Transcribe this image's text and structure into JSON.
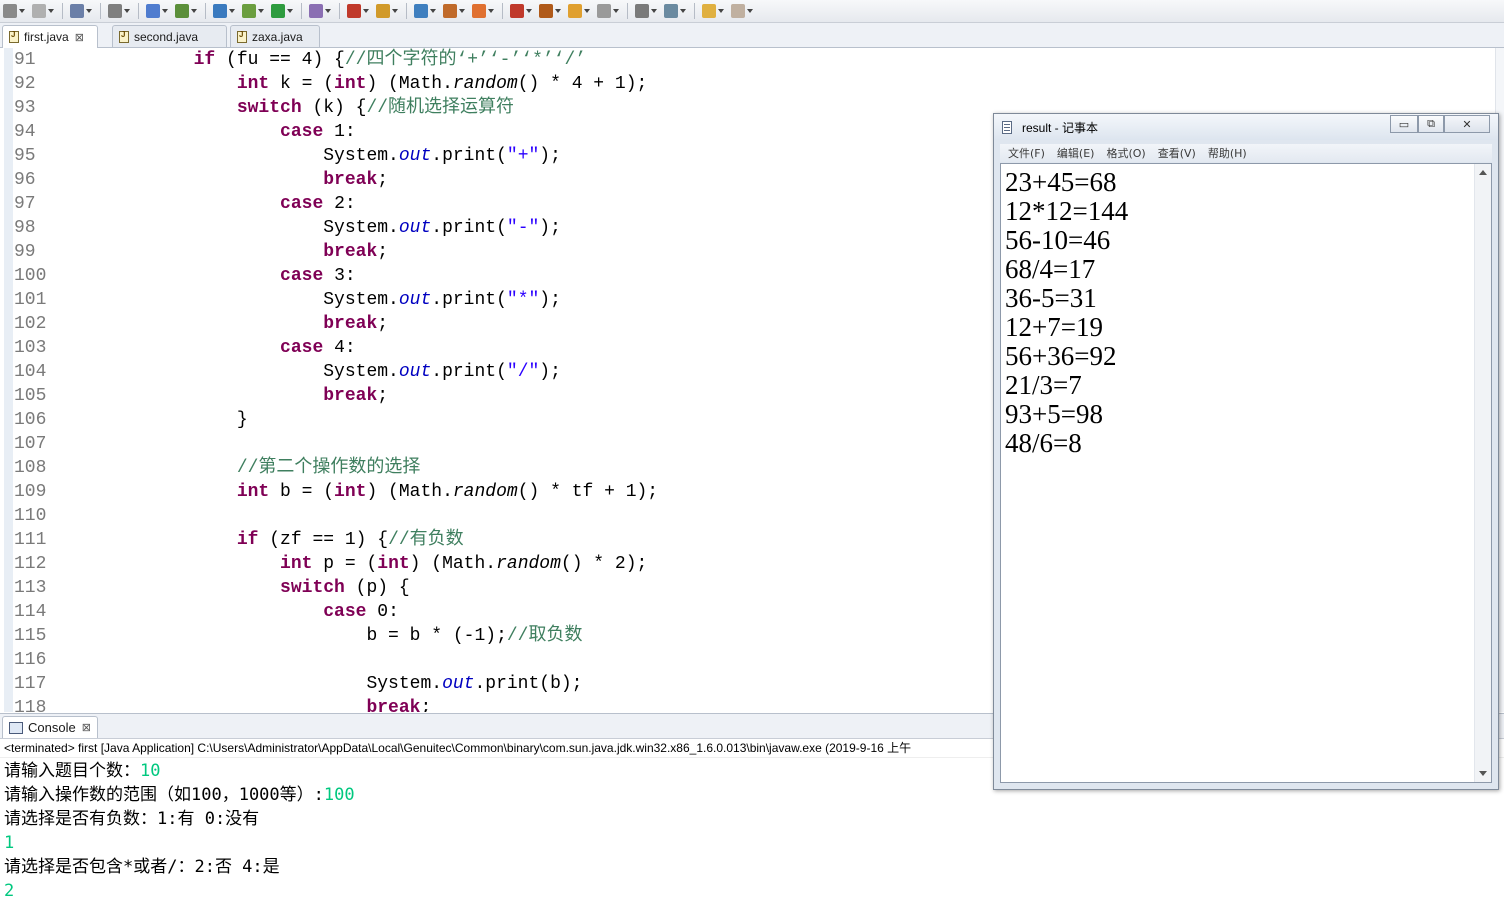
{
  "editor_tabs": [
    {
      "label": "first.java",
      "active": true,
      "close": "⊠"
    },
    {
      "label": "second.java",
      "active": false
    },
    {
      "label": "zaxa.java",
      "active": false
    }
  ],
  "code_lines": [
    {
      "n": "91",
      "code": [
        [
          "            ",
          ""
        ],
        [
          "if",
          "kw"
        ],
        [
          " (fu == 4) {",
          ""
        ],
        [
          "//四个字符的‘+’‘-’‘*’‘/’",
          "cm"
        ]
      ]
    },
    {
      "n": "92",
      "code": [
        [
          "                ",
          ""
        ],
        [
          "int",
          "kw"
        ],
        [
          " k = (",
          ""
        ],
        [
          "int",
          "kw"
        ],
        [
          ") (Math.",
          ""
        ],
        [
          "random",
          "it"
        ],
        [
          "() * 4 + 1);",
          ""
        ]
      ]
    },
    {
      "n": "93",
      "code": [
        [
          "                ",
          ""
        ],
        [
          "switch",
          "kw"
        ],
        [
          " (k) {",
          ""
        ],
        [
          "//随机选择运算符",
          "cm"
        ]
      ]
    },
    {
      "n": "94",
      "code": [
        [
          "                    ",
          ""
        ],
        [
          "case",
          "kw"
        ],
        [
          " 1:",
          ""
        ]
      ]
    },
    {
      "n": "95",
      "code": [
        [
          "                        System.",
          ""
        ],
        [
          "out",
          "fd"
        ],
        [
          ".print(",
          ""
        ],
        [
          "\"+\"",
          "st"
        ],
        [
          ");",
          ""
        ]
      ]
    },
    {
      "n": "96",
      "code": [
        [
          "                        ",
          ""
        ],
        [
          "break",
          "kw"
        ],
        [
          ";",
          ""
        ]
      ]
    },
    {
      "n": "97",
      "code": [
        [
          "                    ",
          ""
        ],
        [
          "case",
          "kw"
        ],
        [
          " 2:",
          ""
        ]
      ]
    },
    {
      "n": "98",
      "code": [
        [
          "                        System.",
          ""
        ],
        [
          "out",
          "fd"
        ],
        [
          ".print(",
          ""
        ],
        [
          "\"-\"",
          "st"
        ],
        [
          ");",
          ""
        ]
      ]
    },
    {
      "n": "99",
      "code": [
        [
          "                        ",
          ""
        ],
        [
          "break",
          "kw"
        ],
        [
          ";",
          ""
        ]
      ]
    },
    {
      "n": "100",
      "code": [
        [
          "                    ",
          ""
        ],
        [
          "case",
          "kw"
        ],
        [
          " 3:",
          ""
        ]
      ]
    },
    {
      "n": "101",
      "code": [
        [
          "                        System.",
          ""
        ],
        [
          "out",
          "fd"
        ],
        [
          ".print(",
          ""
        ],
        [
          "\"*\"",
          "st"
        ],
        [
          ");",
          ""
        ]
      ]
    },
    {
      "n": "102",
      "code": [
        [
          "                        ",
          ""
        ],
        [
          "break",
          "kw"
        ],
        [
          ";",
          ""
        ]
      ]
    },
    {
      "n": "103",
      "code": [
        [
          "                    ",
          ""
        ],
        [
          "case",
          "kw"
        ],
        [
          " 4:",
          ""
        ]
      ]
    },
    {
      "n": "104",
      "code": [
        [
          "                        System.",
          ""
        ],
        [
          "out",
          "fd"
        ],
        [
          ".print(",
          ""
        ],
        [
          "\"/\"",
          "st"
        ],
        [
          ");",
          ""
        ]
      ]
    },
    {
      "n": "105",
      "code": [
        [
          "                        ",
          ""
        ],
        [
          "break",
          "kw"
        ],
        [
          ";",
          ""
        ]
      ]
    },
    {
      "n": "106",
      "code": [
        [
          "                }",
          ""
        ]
      ]
    },
    {
      "n": "107",
      "code": []
    },
    {
      "n": "108",
      "code": [
        [
          "                ",
          ""
        ],
        [
          "//第二个操作数的选择",
          "cm"
        ]
      ]
    },
    {
      "n": "109",
      "code": [
        [
          "                ",
          ""
        ],
        [
          "int",
          "kw"
        ],
        [
          " b = (",
          ""
        ],
        [
          "int",
          "kw"
        ],
        [
          ") (Math.",
          ""
        ],
        [
          "random",
          "it"
        ],
        [
          "() * tf + 1);",
          ""
        ]
      ]
    },
    {
      "n": "110",
      "code": []
    },
    {
      "n": "111",
      "code": [
        [
          "                ",
          ""
        ],
        [
          "if",
          "kw"
        ],
        [
          " (zf == 1) {",
          ""
        ],
        [
          "//有负数",
          "cm"
        ]
      ]
    },
    {
      "n": "112",
      "code": [
        [
          "                    ",
          ""
        ],
        [
          "int",
          "kw"
        ],
        [
          " p = (",
          ""
        ],
        [
          "int",
          "kw"
        ],
        [
          ") (Math.",
          ""
        ],
        [
          "random",
          "it"
        ],
        [
          "() * 2);",
          ""
        ]
      ]
    },
    {
      "n": "113",
      "code": [
        [
          "                    ",
          ""
        ],
        [
          "switch",
          "kw"
        ],
        [
          " (p) {",
          ""
        ]
      ]
    },
    {
      "n": "114",
      "code": [
        [
          "                        ",
          ""
        ],
        [
          "case",
          "kw"
        ],
        [
          " 0:",
          ""
        ]
      ]
    },
    {
      "n": "115",
      "code": [
        [
          "                            b = b * (-1);",
          ""
        ],
        [
          "//取负数",
          "cm"
        ]
      ]
    },
    {
      "n": "116",
      "code": []
    },
    {
      "n": "117",
      "code": [
        [
          "                            System.",
          ""
        ],
        [
          "out",
          "fd"
        ],
        [
          ".print(b);",
          ""
        ]
      ]
    },
    {
      "n": "118",
      "code": [
        [
          "                            ",
          ""
        ],
        [
          "break",
          "kw"
        ],
        [
          ";",
          ""
        ]
      ]
    }
  ],
  "console": {
    "tab_label": "Console",
    "tab_close": "⊠",
    "status": "<terminated> first [Java Application] C:\\Users\\Administrator\\AppData\\Local\\Genuitec\\Common\\binary\\com.sun.java.jdk.win32.x86_1.6.0.013\\bin\\javaw.exe (2019-9-16 上午",
    "lines": [
      {
        "prompt": "请输入题目个数：",
        "input": "10"
      },
      {
        "prompt": "请输入操作数的范围（如100，1000等）:",
        "input": "100"
      },
      {
        "prompt": "请选择是否有负数：1:有 0:没有",
        "input": ""
      },
      {
        "prompt": "",
        "input": "1"
      },
      {
        "prompt": "请选择是否包含*或者/：2:否 4:是",
        "input": ""
      },
      {
        "prompt": "",
        "input": "2"
      }
    ]
  },
  "notepad": {
    "title": "result - 记事本",
    "menu": [
      "文件(F)",
      "编辑(E)",
      "格式(O)",
      "查看(V)",
      "帮助(H)"
    ],
    "buttons": {
      "minimize": "▭",
      "maximize": "⧉",
      "close": "✕"
    },
    "lines": [
      "23+45=68",
      "12*12=144",
      "56-10=46",
      "68/4=17",
      "36-5=31",
      "12+7=19",
      "56+36=92",
      "21/3=7",
      "93+5=98",
      "48/6=8"
    ]
  },
  "toolbar_icon_colors": [
    "#8a8a8a",
    "#b0b0b0",
    "#6b7fa8",
    "#7f7f7f",
    "#4f7ccf",
    "#5b8f3a",
    "#3a7abf",
    "#6b9e3f",
    "#2e9c3f",
    "#8b6fb3",
    "#c0392b",
    "#d19a2a",
    "#3f7fbf",
    "#c06a2a",
    "#e07030",
    "#c0392b",
    "#b05a1a",
    "#e0a030",
    "#9a9a9a",
    "#7a7a7a",
    "#6a8aa0",
    "#e0b040",
    "#c0b0a0"
  ]
}
